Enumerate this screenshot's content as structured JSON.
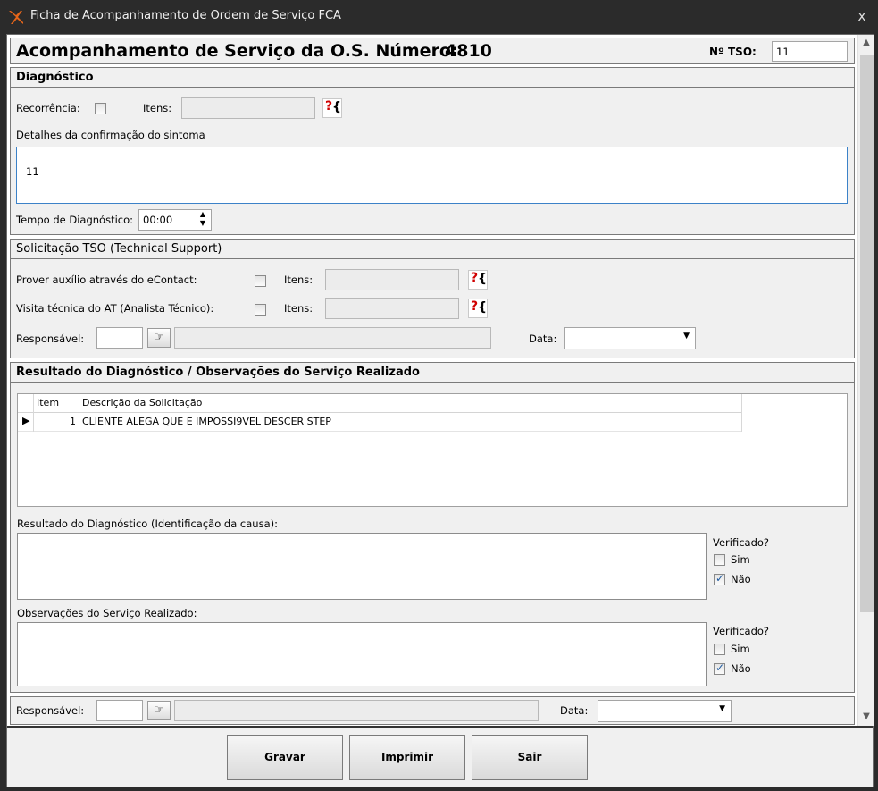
{
  "window": {
    "title": "Ficha de Acompanhamento de Ordem de Serviço FCA",
    "close_label": "x",
    "icon": "x-logo-icon"
  },
  "header": {
    "title": "Acompanhamento de Serviço da O.S. Número:",
    "os_number": "4810",
    "tso_label": "Nº TSO:",
    "tso_value": "11"
  },
  "diagnostico": {
    "title": "Diagnóstico",
    "recorrencia_label": "Recorrência:",
    "itens_label": "Itens:",
    "detalhes_label": "Detalhes da confirmação do sintoma",
    "detalhes_value": "11",
    "tempo_label": "Tempo de Diagnóstico:",
    "tempo_value": "00:00"
  },
  "tso": {
    "title": "Solicitação TSO (Technical Support)",
    "econtact_label": "Prover auxílio através do eContact:",
    "visita_label": "Visita técnica do AT (Analista Técnico):",
    "itens_label": "Itens:",
    "responsavel_label": "Responsável:",
    "data_label": "Data:"
  },
  "resultado": {
    "title": "Resultado do Diagnóstico / Observações do Serviço Realizado",
    "columns": [
      "Item",
      "Descrição da Solicitação"
    ],
    "rows": [
      {
        "item": "1",
        "descricao": "CLIENTE ALEGA QUE E IMPOSSI9VEL DESCER STEP"
      }
    ],
    "resultado_label": "Resultado do Diagnóstico (Identificação da causa):",
    "observacoes_label": "Observações do Serviço Realizado:",
    "verificado_label": "Verificado?",
    "sim_label": "Sim",
    "nao_label": "Não",
    "resultado_sim": false,
    "resultado_nao": true,
    "obs_sim": false,
    "obs_nao": true
  },
  "footer": {
    "responsavel_label": "Responsável:",
    "data_label": "Data:"
  },
  "buttons": {
    "gravar": "Gravar",
    "imprimir": "Imprimir",
    "sair": "Sair"
  }
}
